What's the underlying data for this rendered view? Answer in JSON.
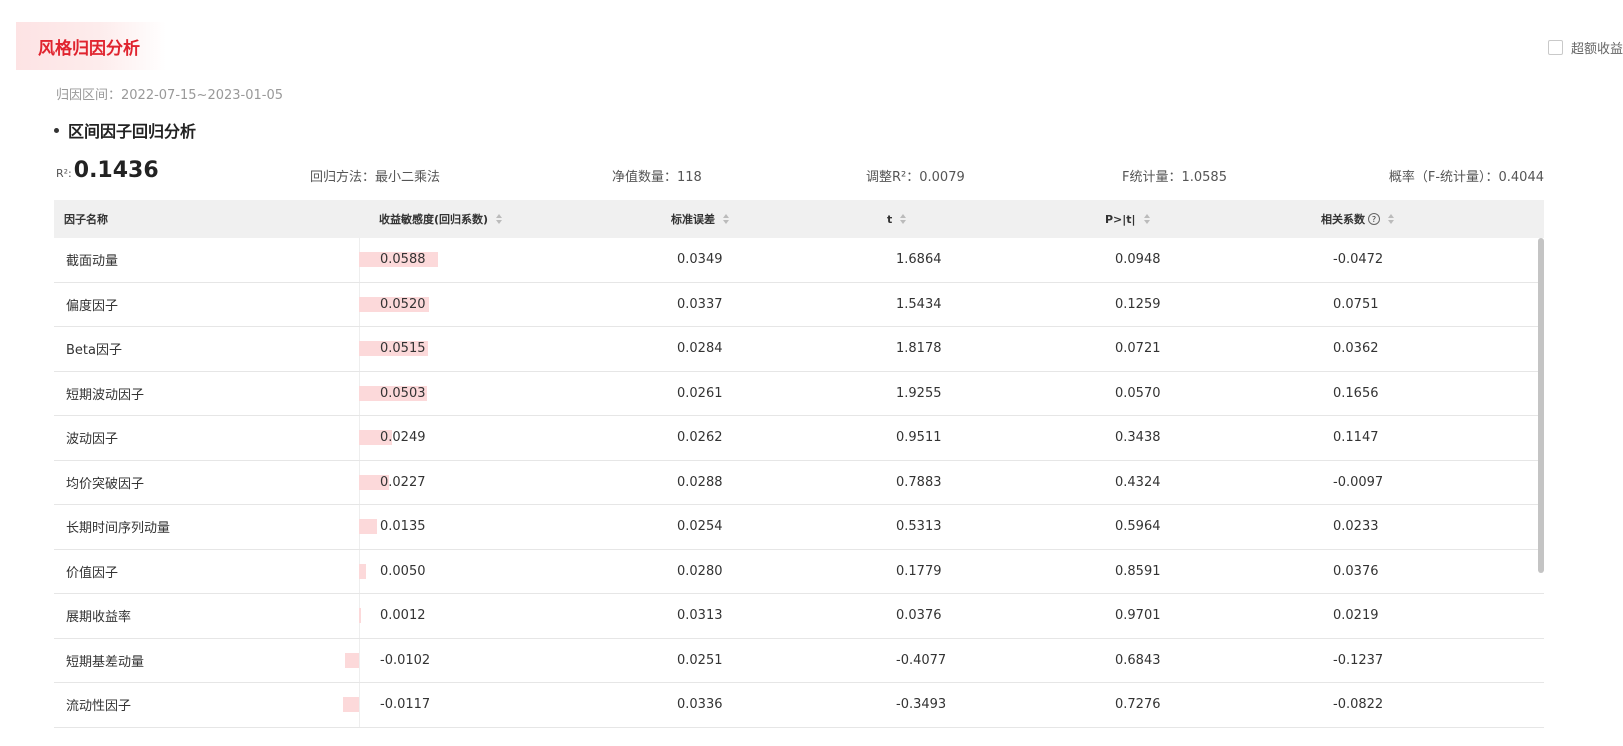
{
  "header": {
    "title": "风格归因分析",
    "excess_label": "超额收益",
    "range": "归因区间：2022-07-15~2023-01-05"
  },
  "section": {
    "title": "区间因子回归分析"
  },
  "stats": {
    "r2_label": "R²:",
    "r2_value": "0.1436",
    "method": "回归方法：最小二乘法",
    "count": "净值数量：118",
    "adj_r2": "调整R²：0.0079",
    "f_stat": "F统计量：1.0585",
    "prob": "概率（F-统计量）：0.4044"
  },
  "table": {
    "columns": [
      "因子名称",
      "收益敏感度(回归系数)",
      "标准误差",
      "t",
      "P>|t|",
      "相关系数"
    ],
    "bar_max": 0.0588,
    "rows": [
      {
        "name": "截面动量",
        "coef": "0.0588",
        "se": "0.0349",
        "t": "1.6864",
        "p": "0.0948",
        "corr": "-0.0472",
        "coef_num": 0.0588
      },
      {
        "name": "偏度因子",
        "coef": "0.0520",
        "se": "0.0337",
        "t": "1.5434",
        "p": "0.1259",
        "corr": "0.0751",
        "coef_num": 0.052
      },
      {
        "name": "Beta因子",
        "coef": "0.0515",
        "se": "0.0284",
        "t": "1.8178",
        "p": "0.0721",
        "corr": "0.0362",
        "coef_num": 0.0515
      },
      {
        "name": "短期波动因子",
        "coef": "0.0503",
        "se": "0.0261",
        "t": "1.9255",
        "p": "0.0570",
        "corr": "0.1656",
        "coef_num": 0.0503
      },
      {
        "name": "波动因子",
        "coef": "0.0249",
        "se": "0.0262",
        "t": "0.9511",
        "p": "0.3438",
        "corr": "0.1147",
        "coef_num": 0.0249
      },
      {
        "name": "均价突破因子",
        "coef": "0.0227",
        "se": "0.0288",
        "t": "0.7883",
        "p": "0.4324",
        "corr": "-0.0097",
        "coef_num": 0.0227
      },
      {
        "name": "长期时间序列动量",
        "coef": "0.0135",
        "se": "0.0254",
        "t": "0.5313",
        "p": "0.5964",
        "corr": "0.0233",
        "coef_num": 0.0135
      },
      {
        "name": "价值因子",
        "coef": "0.0050",
        "se": "0.0280",
        "t": "0.1779",
        "p": "0.8591",
        "corr": "0.0376",
        "coef_num": 0.005
      },
      {
        "name": "展期收益率",
        "coef": "0.0012",
        "se": "0.0313",
        "t": "0.0376",
        "p": "0.9701",
        "corr": "0.0219",
        "coef_num": 0.0012
      },
      {
        "name": "短期基差动量",
        "coef": "-0.0102",
        "se": "0.0251",
        "t": "-0.4077",
        "p": "0.6843",
        "corr": "-0.1237",
        "coef_num": -0.0102
      },
      {
        "name": "流动性因子",
        "coef": "-0.0117",
        "se": "0.0336",
        "t": "-0.3493",
        "p": "0.7276",
        "corr": "-0.0822",
        "coef_num": -0.0117
      }
    ]
  },
  "colors": {
    "accent": "#e0242f",
    "bar": "#fcd9da",
    "header_bg": "#f0f0f0"
  }
}
